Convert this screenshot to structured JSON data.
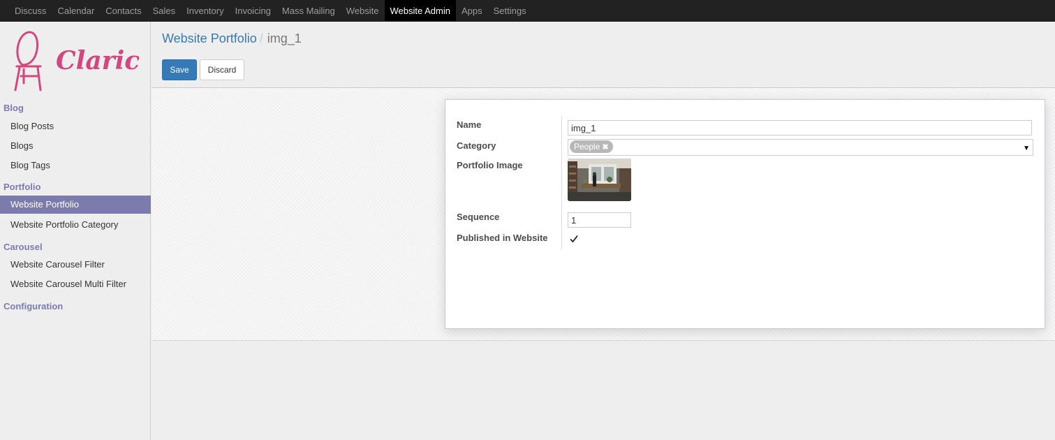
{
  "topbar": {
    "items": [
      "Discuss",
      "Calendar",
      "Contacts",
      "Sales",
      "Inventory",
      "Invoicing",
      "Mass Mailing",
      "Website",
      "Website Admin",
      "Apps",
      "Settings"
    ],
    "active": "Website Admin"
  },
  "sidebar": {
    "logo_text": "Clarico",
    "sections": {
      "blog": "Blog",
      "portfolio": "Portfolio",
      "carousel": "Carousel",
      "configuration": "Configuration"
    },
    "items": {
      "blog_posts": "Blog Posts",
      "blogs": "Blogs",
      "blog_tags": "Blog Tags",
      "website_portfolio": "Website Portfolio",
      "website_portfolio_category": "Website Portfolio Category",
      "carousel_filter": "Website Carousel Filter",
      "carousel_multi_filter": "Website Carousel Multi Filter"
    },
    "active_item": "Website Portfolio"
  },
  "breadcrumb": {
    "parent": "Website Portfolio",
    "separator": "/",
    "current": "img_1"
  },
  "buttons": {
    "save": "Save",
    "discard": "Discard"
  },
  "form": {
    "name_label": "Name",
    "name_value": "img_1",
    "category_label": "Category",
    "category_tag": "People",
    "image_label": "Portfolio Image",
    "sequence_label": "Sequence",
    "sequence_value": "1",
    "published_label": "Published in Website",
    "published": true
  },
  "icons": {
    "tag_remove": "✖",
    "dropdown": "▼"
  },
  "colors": {
    "accent": "#7c7bad",
    "link": "#337ab7",
    "primary_button": "#337ab7",
    "logo": "#d2487e",
    "topbar": "#222222"
  }
}
